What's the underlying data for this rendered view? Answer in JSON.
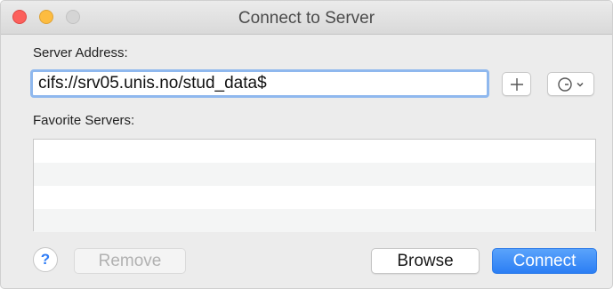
{
  "window": {
    "title": "Connect to Server"
  },
  "server_address": {
    "label": "Server Address:",
    "value": "cifs://srv05.unis.no/stud_data$"
  },
  "favorites": {
    "label": "Favorite Servers:",
    "rows": [
      "",
      "",
      "",
      ""
    ]
  },
  "buttons": {
    "help": "?",
    "remove": "Remove",
    "browse": "Browse",
    "connect": "Connect",
    "add_icon": "plus-icon",
    "recent_icon": "clock-icon"
  },
  "colors": {
    "accent": "#2b7ef4",
    "focus_ring": "#8fb8ee"
  }
}
